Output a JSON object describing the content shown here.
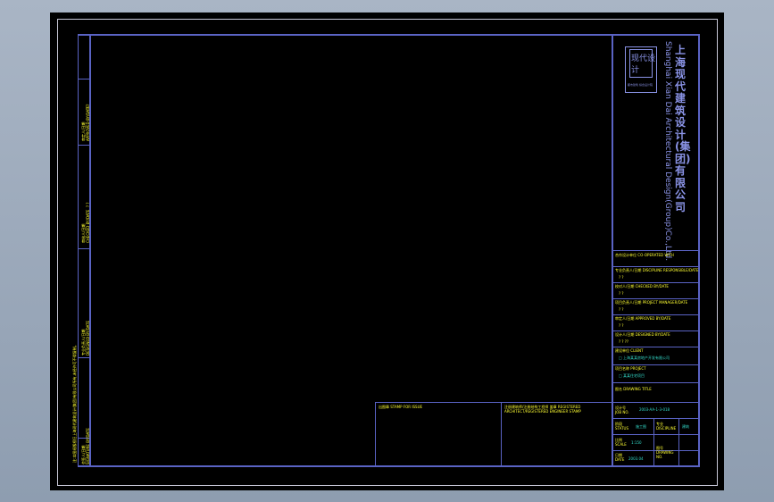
{
  "firm": {
    "name_cn": "上海现代建筑设计(集团)有限公司",
    "name_en": "Shanghai Xian Dai Architectural Design(Group)Co.,Ltd.",
    "logo_text": "现代设计",
    "logo_sub": "都市建筑 综合设计院"
  },
  "left_strip": {
    "approver": "审定人/日期",
    "approver_en": "APPROVED BY/DATE",
    "approver_val": "? ?",
    "reviewer": "审核人/日期",
    "reviewer_en": "CHECKED BY/DATE",
    "reviewer_val": "? ?",
    "designer": "专业负责人/日期",
    "designer_en": "DESIGNED BY/DATE",
    "note": "注:本图纸版权归上海现代建筑设计(集团)有限公司所有,未经许可不得复制。",
    "bottom": "会签人/日期",
    "bottom_en": "SIGNATURE BY/DATE"
  },
  "title_block": {
    "reg_label": "合作设计单位 CO-OPERATED WITH",
    "r1_label": "专业负责人/日期 DISCIPLINE RESPONSIBLE/DATE",
    "r1_val": "? ?",
    "r2_label": "校对人/日期 CHECKED BY/DATE",
    "r2_val": "? ?",
    "r3_label": "项目负责人/日期 PROJECT MANAGER/DATE",
    "r3_val": "? ?",
    "r4_label": "审定人/日期 APPROVED BY/DATE",
    "r4_val": "? ?",
    "r5_label": "设计人/日期 DESIGNED BY/DATE",
    "r5_val": "? ? ??",
    "client_label": "建设单位 CLIENT",
    "client_val": "□ 上海某某房地产开发有限公司",
    "project_label": "项目名称 PROJECT",
    "project_val": "□ 某某住宅项目",
    "drawing_label": "图名 DRAWING TITLE",
    "job_label": "设计号 JOB NO.",
    "job_val": "2003-AA-1-3-018",
    "status_label": "阶段 STATUS",
    "status_val": "施工图",
    "disc_label": "专业 DISCIPLINE",
    "disc_val": "建筑",
    "scale_label": "比例 SCALE",
    "scale_val": "1:150",
    "dwgno_label": "图号 DRAWING NO.",
    "date_label": "日期 DATE",
    "date_val": "2003.04",
    "stamp_label": "出图章 STAMP FOR ISSUE",
    "arch_label": "注册建筑师/注册结构工程师 盖章 REGISTERED ARCHITECT/REGISTERED ENGINEER STAMP"
  }
}
